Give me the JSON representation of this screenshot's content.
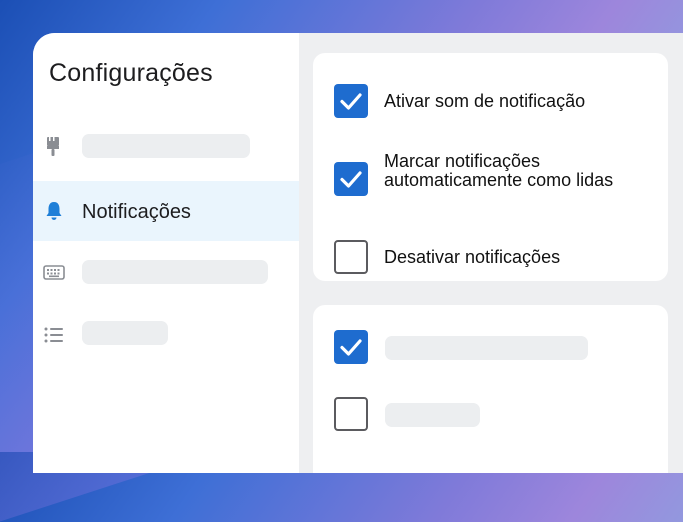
{
  "sidebar": {
    "title": "Configurações",
    "items": [
      {
        "icon": "paintbrush-icon",
        "label": "",
        "active": false
      },
      {
        "icon": "bell-icon",
        "label": "Notificações",
        "active": true
      },
      {
        "icon": "keyboard-icon",
        "label": "",
        "active": false
      },
      {
        "icon": "list-icon",
        "label": "",
        "active": false
      }
    ]
  },
  "notifications": {
    "options": [
      {
        "label": "Ativar som de notificação",
        "checked": true
      },
      {
        "label": "Marcar notificações automaticamente como lidas",
        "checked": true
      },
      {
        "label": "Desativar notificações",
        "checked": false
      }
    ]
  },
  "second_card": {
    "options": [
      {
        "label": "",
        "checked": true
      },
      {
        "label": "",
        "checked": false
      }
    ]
  },
  "colors": {
    "accent": "#1e6ccf",
    "active_bg": "#eaf5fd",
    "icon_gray": "#8a8d93",
    "bell_blue": "#1e7fd8"
  }
}
